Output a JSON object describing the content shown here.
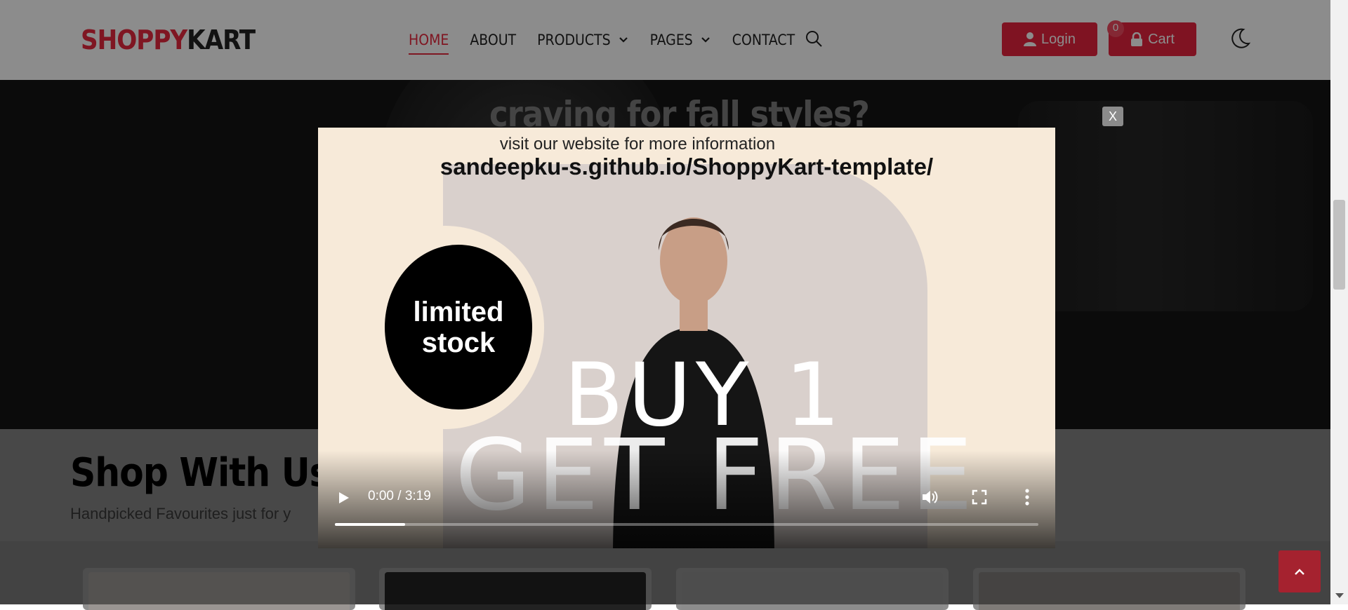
{
  "header": {
    "logo_part1": "SHOPPY",
    "logo_part2": "KART",
    "nav": [
      {
        "label": "HOME",
        "active": true
      },
      {
        "label": "ABOUT"
      },
      {
        "label": "PRODUCTS",
        "dropdown": true
      },
      {
        "label": "PAGES",
        "dropdown": true
      },
      {
        "label": "CONTACT"
      }
    ],
    "login_label": "Login",
    "cart_label": "Cart",
    "cart_count": "0",
    "accent_color": "#e8233e"
  },
  "hero": {
    "headline": "craving for fall styles?"
  },
  "shop": {
    "title": "Shop With Us",
    "subtitle": "Handpicked Favourites just for y"
  },
  "modal": {
    "close_label": "X",
    "video": {
      "line1": "visit our website for more information",
      "line2": "sandeepku-s.github.io/ShoppyKart-template/",
      "badge_line1": "limited",
      "badge_line2": "stock",
      "promo_line1": "BUY 1",
      "promo_line2": "GET FREE",
      "time": "0:00 / 3:19",
      "buffered_fraction": 0.1
    }
  }
}
